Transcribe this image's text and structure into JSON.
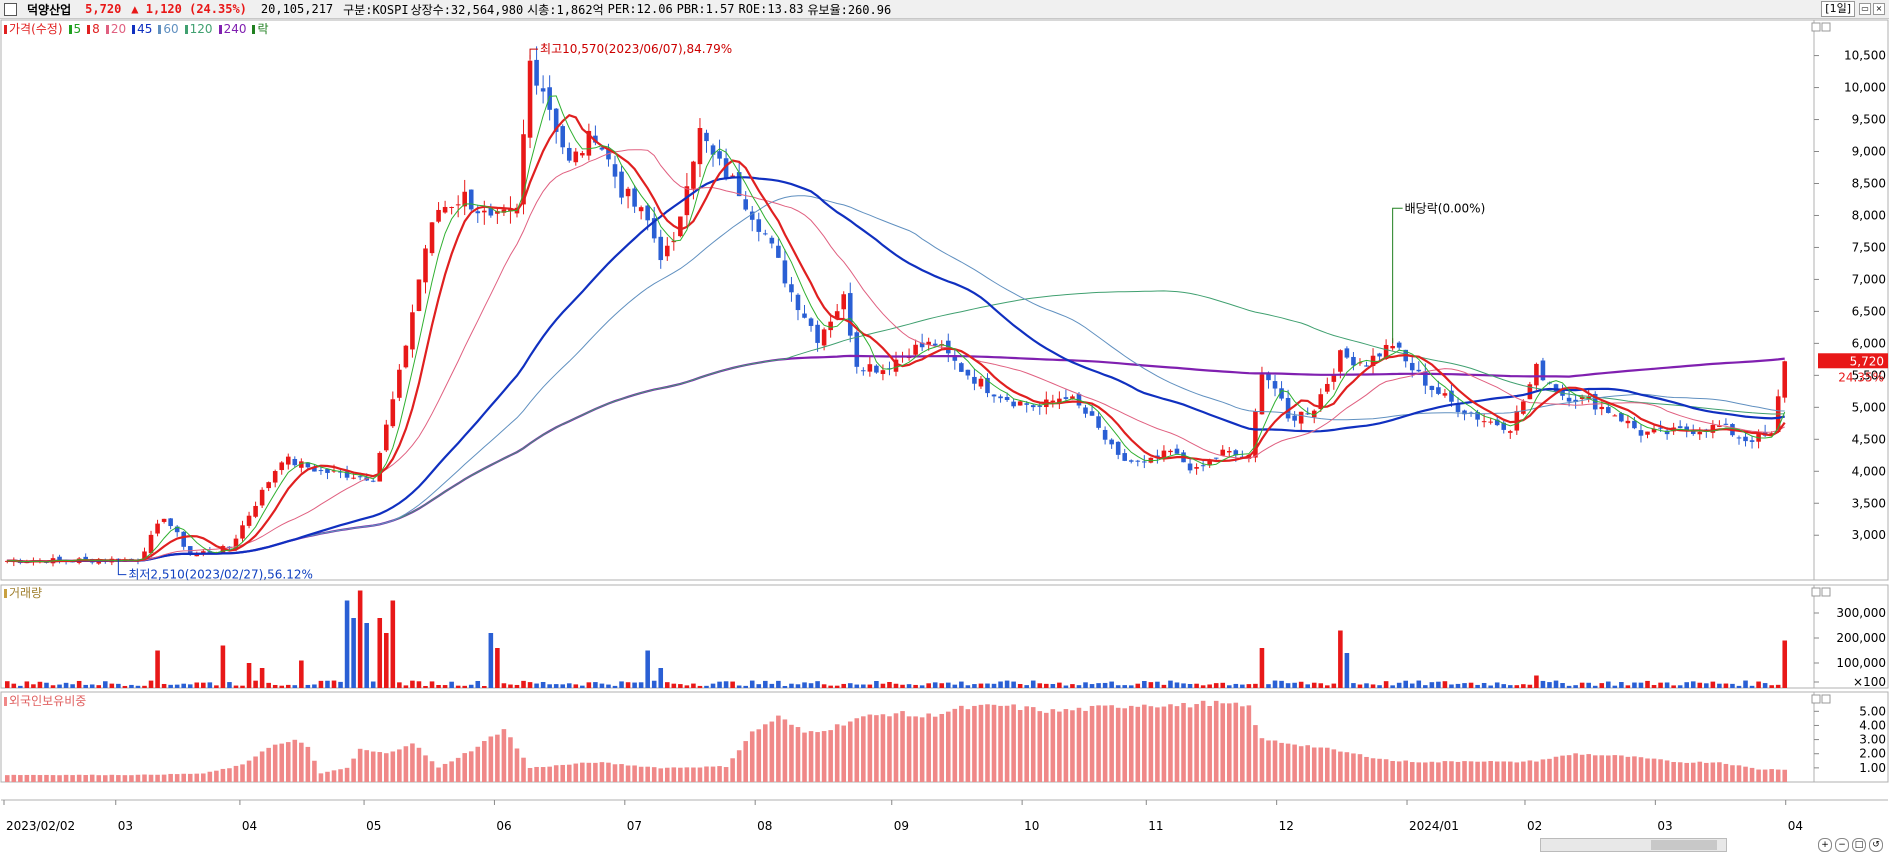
{
  "header": {
    "name": "덕양산업",
    "price": "5,720",
    "change": "▲ 1,120 (24.35%)",
    "volume": "20,105,217",
    "market": "구분:KOSPI",
    "shares": "상장수:32,564,980",
    "mktcap": "시총:1,862억",
    "per": "PER:12.06",
    "pbr": "PBR:1.57",
    "roe": "ROE:13.83",
    "float": "유보율:260.96",
    "period": "[1일]"
  },
  "legend": [
    {
      "label": "가격(수정)",
      "color": "#e02020"
    },
    {
      "label": "5",
      "color": "#20a020"
    },
    {
      "label": "8",
      "color": "#e02020"
    },
    {
      "label": "20",
      "color": "#e06080"
    },
    {
      "label": "45",
      "color": "#1030c0"
    },
    {
      "label": "60",
      "color": "#6090c0"
    },
    {
      "label": "120",
      "color": "#40a070"
    },
    {
      "label": "240",
      "color": "#8020b0"
    },
    {
      "label": "락",
      "color": "#208020"
    }
  ],
  "panels": {
    "volume_title": "거래량",
    "foreign_title": "외국인보유비중"
  },
  "colors": {
    "up": "#e81818",
    "down": "#2a5fd4",
    "foreign": "#f08888"
  },
  "chart_data": [
    {
      "type": "candlestick",
      "title": "",
      "y_ticks": [
        "10,500",
        "10,000",
        "9,500",
        "9,000",
        "8,500",
        "8,000",
        "7,500",
        "7,000",
        "6,500",
        "6,000",
        "5,500",
        "5,000",
        "4,500",
        "4,000",
        "3,500",
        "3,000"
      ],
      "y_tick_values": [
        10500,
        10000,
        9500,
        9000,
        8500,
        8000,
        7500,
        7000,
        6500,
        6000,
        5500,
        5000,
        4500,
        4000,
        3500,
        3000
      ],
      "ylim": [
        2300,
        10900
      ],
      "x_labels": [
        "2023/02/02",
        "03",
        "04",
        "05",
        "06",
        "07",
        "08",
        "09",
        "10",
        "11",
        "12",
        "2024/01",
        "02",
        "03",
        "04"
      ],
      "annotations": {
        "high": "최고10,570(2023/06/07),84.79%",
        "low": "최저2,510(2023/02/27),56.12%",
        "dividend": "배당락(0.00%)",
        "last_price": "5,720",
        "last_pct": "24.35%"
      },
      "close_anchors": [
        [
          0,
          2600
        ],
        [
          20,
          2620
        ],
        [
          24,
          3300
        ],
        [
          28,
          2700
        ],
        [
          34,
          2800
        ],
        [
          38,
          3500
        ],
        [
          42,
          4200
        ],
        [
          48,
          4000
        ],
        [
          56,
          3900
        ],
        [
          60,
          5500
        ],
        [
          64,
          7500
        ],
        [
          66,
          8100
        ],
        [
          70,
          8300
        ],
        [
          74,
          7900
        ],
        [
          78,
          8050
        ],
        [
          80,
          10400
        ],
        [
          82,
          10000
        ],
        [
          86,
          8800
        ],
        [
          90,
          9300
        ],
        [
          94,
          8400
        ],
        [
          98,
          7900
        ],
        [
          100,
          7400
        ],
        [
          102,
          7500
        ],
        [
          104,
          8600
        ],
        [
          106,
          9300
        ],
        [
          108,
          8900
        ],
        [
          112,
          8400
        ],
        [
          116,
          7700
        ],
        [
          120,
          6800
        ],
        [
          124,
          6100
        ],
        [
          128,
          6700
        ],
        [
          130,
          5700
        ],
        [
          134,
          5600
        ],
        [
          138,
          5900
        ],
        [
          142,
          6000
        ],
        [
          146,
          5600
        ],
        [
          150,
          5300
        ],
        [
          154,
          5100
        ],
        [
          158,
          5000
        ],
        [
          162,
          5200
        ],
        [
          166,
          4800
        ],
        [
          170,
          4200
        ],
        [
          174,
          4100
        ],
        [
          178,
          4300
        ],
        [
          182,
          4000
        ],
        [
          186,
          4300
        ],
        [
          190,
          4200
        ],
        [
          192,
          5600
        ],
        [
          194,
          5300
        ],
        [
          196,
          4800
        ],
        [
          200,
          5000
        ],
        [
          204,
          5800
        ],
        [
          208,
          5700
        ],
        [
          212,
          6000
        ],
        [
          214,
          5700
        ],
        [
          218,
          5300
        ],
        [
          222,
          5000
        ],
        [
          226,
          4800
        ],
        [
          230,
          4700
        ],
        [
          232,
          5100
        ],
        [
          234,
          5600
        ],
        [
          238,
          5200
        ],
        [
          242,
          5100
        ],
        [
          246,
          4900
        ],
        [
          250,
          4600
        ],
        [
          254,
          4600
        ],
        [
          258,
          4650
        ],
        [
          262,
          4700
        ],
        [
          266,
          4500
        ],
        [
          270,
          4550
        ],
        [
          272,
          5720
        ]
      ],
      "ma_colors": {
        "ma5": "#30b030",
        "ma8": "#e02020",
        "ma20": "#e06080",
        "ma45": "#1030c0",
        "ma60": "#6090c0",
        "ma120": "#40a070",
        "ma240": "#8020b0"
      }
    },
    {
      "type": "bar",
      "title": "거래량",
      "y_ticks": [
        "300,000",
        "200,000",
        "100,000",
        "×100"
      ],
      "y_tick_values": [
        300000,
        200000,
        100000,
        0
      ],
      "ylim": [
        0,
        380000
      ],
      "spikes": [
        [
          23,
          150000
        ],
        [
          33,
          170000
        ],
        [
          37,
          100000
        ],
        [
          39,
          80000
        ],
        [
          45,
          110000
        ],
        [
          52,
          350000
        ],
        [
          53,
          280000
        ],
        [
          54,
          390000
        ],
        [
          55,
          260000
        ],
        [
          57,
          280000
        ],
        [
          58,
          220000
        ],
        [
          59,
          350000
        ],
        [
          74,
          220000
        ],
        [
          75,
          160000
        ],
        [
          98,
          150000
        ],
        [
          100,
          80000
        ],
        [
          192,
          160000
        ],
        [
          204,
          230000
        ],
        [
          205,
          140000
        ],
        [
          234,
          50000
        ],
        [
          272,
          190000
        ]
      ]
    },
    {
      "type": "bar",
      "title": "외국인보유비중",
      "y_ticks": [
        "5.00",
        "4.00",
        "3.00",
        "2.00",
        "1.00"
      ],
      "y_tick_values": [
        5,
        4,
        3,
        2,
        1
      ],
      "ylim": [
        0,
        5.8
      ],
      "anchors": [
        [
          0,
          0.5
        ],
        [
          20,
          0.5
        ],
        [
          30,
          0.6
        ],
        [
          36,
          1.2
        ],
        [
          40,
          2.5
        ],
        [
          44,
          2.9
        ],
        [
          46,
          2.5
        ],
        [
          48,
          0.6
        ],
        [
          52,
          1.0
        ],
        [
          54,
          2.3
        ],
        [
          58,
          2.0
        ],
        [
          62,
          2.8
        ],
        [
          66,
          1.0
        ],
        [
          72,
          2.5
        ],
        [
          76,
          3.8
        ],
        [
          80,
          1.0
        ],
        [
          90,
          1.4
        ],
        [
          100,
          1.0
        ],
        [
          110,
          1.1
        ],
        [
          114,
          3.5
        ],
        [
          118,
          4.6
        ],
        [
          122,
          3.5
        ],
        [
          126,
          3.8
        ],
        [
          130,
          4.5
        ],
        [
          136,
          4.9
        ],
        [
          140,
          4.6
        ],
        [
          146,
          5.2
        ],
        [
          152,
          5.4
        ],
        [
          160,
          5.0
        ],
        [
          166,
          5.2
        ],
        [
          174,
          5.5
        ],
        [
          180,
          5.4
        ],
        [
          184,
          5.6
        ],
        [
          190,
          5.3
        ],
        [
          192,
          3.0
        ],
        [
          200,
          2.5
        ],
        [
          206,
          2.0
        ],
        [
          212,
          1.5
        ],
        [
          218,
          1.4
        ],
        [
          224,
          1.5
        ],
        [
          230,
          1.4
        ],
        [
          234,
          1.5
        ],
        [
          240,
          2.0
        ],
        [
          248,
          1.8
        ],
        [
          256,
          1.4
        ],
        [
          262,
          1.4
        ],
        [
          268,
          0.9
        ],
        [
          272,
          0.9
        ]
      ]
    }
  ]
}
